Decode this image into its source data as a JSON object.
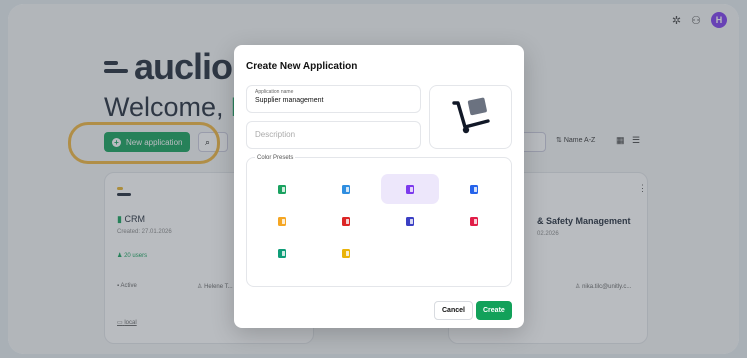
{
  "app": {
    "logo_text": "auclio",
    "welcome_prefix": "Welcome, ",
    "welcome_name": "H",
    "avatar_letter": "H"
  },
  "toolbar": {
    "new_application_label": "New application",
    "sort_label": "Name A-Z"
  },
  "cards": {
    "crm": {
      "title": "CRM",
      "created": "Created: 27.01.2026",
      "users": "20 users",
      "status": "Active",
      "owner": "Helene T...",
      "storage": "local"
    },
    "safety": {
      "title": "& Safety Management",
      "date": "02.2026",
      "owner_email": "nika.tilc@unitly.c..."
    }
  },
  "modal": {
    "title": "Create New Application",
    "application_name_label": "Application name",
    "application_name_value": "Supplier management",
    "description_placeholder": "Description",
    "color_presets_label": "Color Presets",
    "cancel_label": "Cancel",
    "create_label": "Create",
    "selected_icon": "hand-truck-icon",
    "presets": [
      {
        "color": "#1aa260",
        "selected": false
      },
      {
        "color": "#2f8ee0",
        "selected": false
      },
      {
        "color": "#7c3aed",
        "selected": true
      },
      {
        "color": "#2563eb",
        "selected": false
      },
      {
        "color": "#f5a623",
        "selected": false
      },
      {
        "color": "#dc2626",
        "selected": false
      },
      {
        "color": "#3b3fc4",
        "selected": false
      },
      {
        "color": "#e11d48",
        "selected": false
      },
      {
        "color": "#0f9d78",
        "selected": false
      },
      {
        "color": "#eab308",
        "selected": false
      }
    ]
  }
}
